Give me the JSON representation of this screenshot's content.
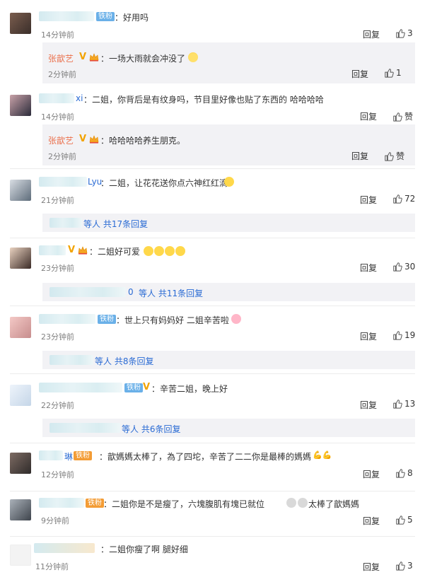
{
  "labels": {
    "reply": "回复",
    "like": "赞"
  },
  "badges": {
    "fan": "铁粉",
    "v": "V"
  },
  "comments": [
    {
      "name": "",
      "text": "：好用吗",
      "time": "14分钟前",
      "likes": "3"
    },
    {
      "name": "张歆艺",
      "text": "：一场大雨就会冲没了",
      "time": "2分钟前",
      "likes": "1"
    },
    {
      "name": "xi",
      "text": "：二姐，你背后是有纹身吗，节目里好像也贴了东西的 哈哈哈哈",
      "time": "14分钟前",
      "likes": "赞"
    },
    {
      "name": "张歆艺",
      "text": "：哈哈哈哈养生朋克。",
      "time": "2分钟前",
      "likes": "赞"
    },
    {
      "name": "Lyu",
      "text": "：二姐，让花花送你点六神红红滴",
      "time": "21分钟前",
      "likes": "72",
      "more": "等人 共17条回复"
    },
    {
      "name": "",
      "text": "：二姐好可爱",
      "time": "23分钟前",
      "likes": "30",
      "more_prefix": "0",
      "more": "等人 共11条回复"
    },
    {
      "name": "",
      "text": "：世上只有妈妈好 二姐辛苦啦",
      "time": "23分钟前",
      "likes": "19",
      "more": "等人 共8条回复"
    },
    {
      "name": "",
      "text": "：辛苦二姐，晚上好",
      "time": "22分钟前",
      "likes": "13",
      "more": "等人 共6条回复"
    },
    {
      "name": "琳",
      "text": "：歆媽媽太棒了，為了四坨，辛苦了二二你是最棒的媽媽",
      "time": "12分钟前",
      "likes": "8"
    },
    {
      "name": "",
      "text": "：二姐你是不是瘦了，六塊腹肌有塊已就位",
      "text2": "太棒了歆媽媽",
      "time": "9分钟前",
      "likes": "5"
    },
    {
      "name": "",
      "text": "：二姐你瘦了啊 腿好细",
      "time": "11分钟前",
      "likes": "3"
    }
  ]
}
